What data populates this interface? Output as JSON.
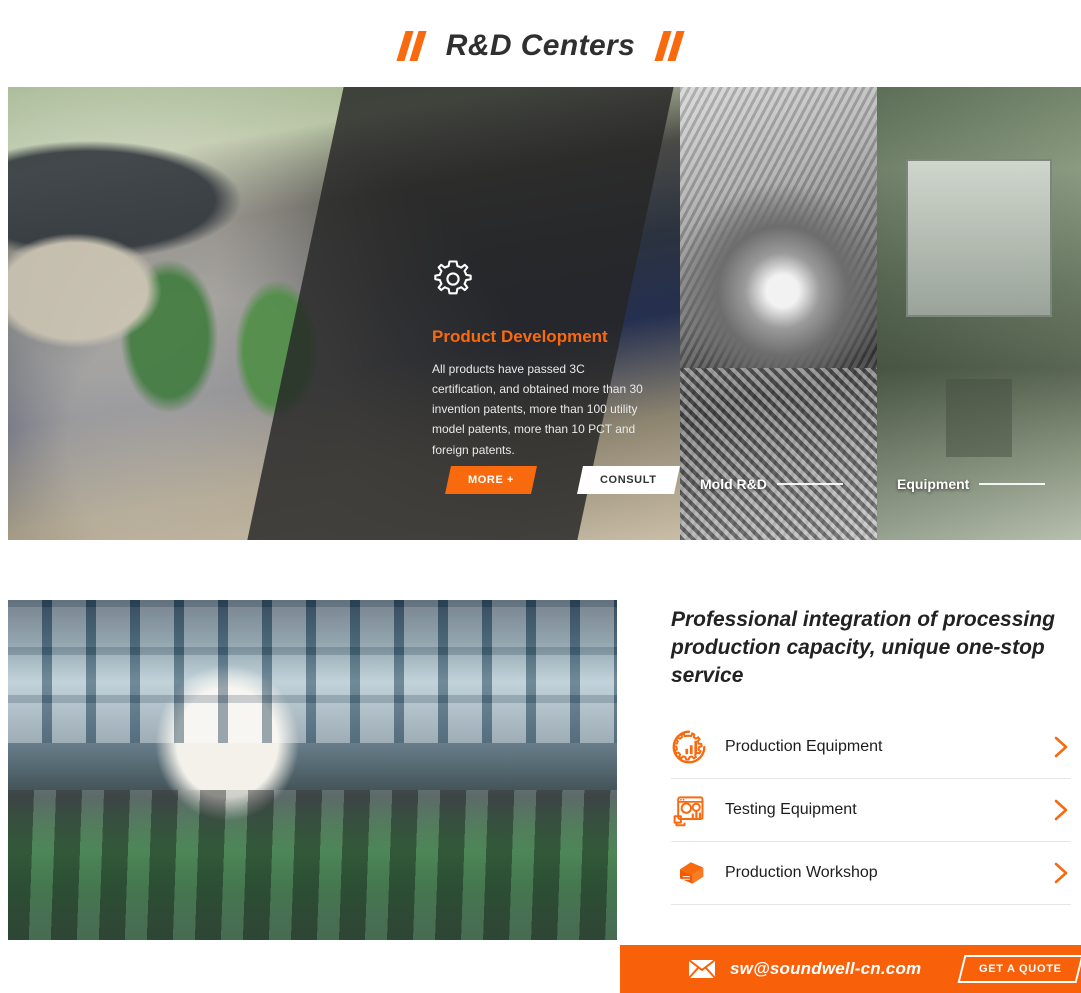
{
  "section": {
    "title": "R&D Centers",
    "accent_color": "#F96A0F"
  },
  "gallery": {
    "panels": [
      {
        "id": "product-development",
        "icon": "gear-icon",
        "title": "Product Development",
        "description": "All products have passed 3C certification, and obtained more than 30 invention patents, more than 100 utility model patents, more than 10 PCT and foreign patents.",
        "buttons": [
          {
            "label": "MORE +",
            "style": "primary"
          },
          {
            "label": "CONSULT",
            "style": "light"
          }
        ]
      },
      {
        "id": "mold-rd",
        "label": "Mold R&D"
      },
      {
        "id": "equipment",
        "label": "Equipment"
      }
    ]
  },
  "lower": {
    "lead": "Professional integration of processing production capacity, unique one-stop service",
    "services": [
      {
        "label": "Production Equipment",
        "icon": "gear-chart-icon"
      },
      {
        "label": "Testing Equipment",
        "icon": "testing-meter-icon"
      },
      {
        "label": "Production Workshop",
        "icon": "workshop-book-icon"
      }
    ]
  },
  "cta": {
    "icon": "mail-icon",
    "email": "sw@soundwell-cn.com",
    "button_label": "GET A QUOTE",
    "background_color": "#F9600A"
  }
}
